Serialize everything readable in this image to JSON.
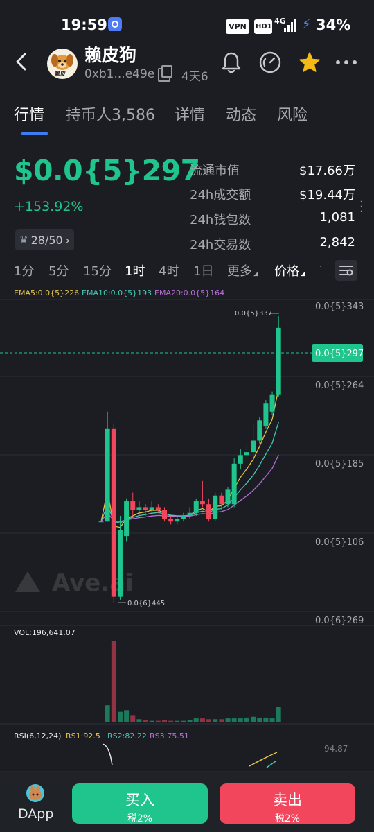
{
  "status_bar": {
    "time": "19:59",
    "vpn": "VPN",
    "hd": "HD1",
    "network": "4G",
    "battery": "34%"
  },
  "header": {
    "token_name": "赖皮狗",
    "address": "0xb1...e49e",
    "age": "4天6",
    "logo_text": "赖皮"
  },
  "tabs": [
    "行情",
    "持币人3,586",
    "详情",
    "动态",
    "风险"
  ],
  "price": {
    "value": "$0.0{5}297",
    "change": "+153.92%",
    "rank": "28/50"
  },
  "stats": [
    {
      "label": "流通市值",
      "value": "$17.66万"
    },
    {
      "label": "24h成交额",
      "value": "$19.44万"
    },
    {
      "label": "24h钱包数",
      "value": "1,081"
    },
    {
      "label": "24h交易数",
      "value": "2,842"
    }
  ],
  "timeframes": [
    "1分",
    "5分",
    "15分",
    "1时",
    "4时",
    "1日",
    "更多",
    "价格"
  ],
  "active_timeframe": "1时",
  "ema": {
    "ema5": "EMA5:0.0{5}226",
    "ema10": "EMA10:0.0{5}193",
    "ema20": "EMA20:0.0{5}164"
  },
  "chart": {
    "price_axis": [
      "0.0{5}343",
      "0.0{5}264",
      "0.0{5}185",
      "0.0{5}106",
      "0.0{6}269"
    ],
    "current_price_tag": "0.0{5}297",
    "high_label": "0.0{5}337",
    "low_label": "0.0{6}445",
    "watermark": "Ave.ai",
    "volume_label": "VOL:196,641.07",
    "rsi_label": "RSI(6,12,24)",
    "rsi1": "RS1:92.5",
    "rsi2": "RS2:82.22",
    "rsi3": "RS3:75.51",
    "rsi_axis": "94.87"
  },
  "colors": {
    "up": "#1fc58c",
    "down": "#f2465d",
    "ema5": "#e8c547",
    "ema10": "#46c7b4",
    "ema20": "#b76fd8",
    "accent": "#3d7cf2",
    "star": "#f5b915"
  },
  "chart_data": {
    "type": "candlestick",
    "interval": "1时",
    "candles_relative": [
      {
        "o": 0.28,
        "c": 0.28,
        "h": 0.28,
        "l": 0.28
      },
      {
        "o": 0.28,
        "c": 0.6,
        "h": 0.66,
        "l": 0.28
      },
      {
        "o": 0.6,
        "c": 0.02,
        "h": 0.62,
        "l": 0.0
      },
      {
        "o": 0.02,
        "c": 0.25,
        "h": 0.3,
        "l": 0.01
      },
      {
        "o": 0.23,
        "c": 0.35,
        "h": 0.36,
        "l": 0.21
      },
      {
        "o": 0.35,
        "c": 0.32,
        "h": 0.38,
        "l": 0.3
      },
      {
        "o": 0.32,
        "c": 0.33,
        "h": 0.35,
        "l": 0.3
      },
      {
        "o": 0.33,
        "c": 0.32,
        "h": 0.34,
        "l": 0.3
      },
      {
        "o": 0.32,
        "c": 0.33,
        "h": 0.35,
        "l": 0.31
      },
      {
        "o": 0.33,
        "c": 0.32,
        "h": 0.34,
        "l": 0.31
      },
      {
        "o": 0.32,
        "c": 0.29,
        "h": 0.33,
        "l": 0.28
      },
      {
        "o": 0.29,
        "c": 0.28,
        "h": 0.3,
        "l": 0.27
      },
      {
        "o": 0.28,
        "c": 0.29,
        "h": 0.3,
        "l": 0.27
      },
      {
        "o": 0.29,
        "c": 0.3,
        "h": 0.31,
        "l": 0.28
      },
      {
        "o": 0.3,
        "c": 0.31,
        "h": 0.33,
        "l": 0.29
      },
      {
        "o": 0.31,
        "c": 0.35,
        "h": 0.36,
        "l": 0.3
      },
      {
        "o": 0.35,
        "c": 0.34,
        "h": 0.42,
        "l": 0.33
      },
      {
        "o": 0.34,
        "c": 0.29,
        "h": 0.36,
        "l": 0.28
      },
      {
        "o": 0.29,
        "c": 0.37,
        "h": 0.38,
        "l": 0.28
      },
      {
        "o": 0.37,
        "c": 0.34,
        "h": 0.38,
        "l": 0.32
      },
      {
        "o": 0.34,
        "c": 0.39,
        "h": 0.4,
        "l": 0.33
      },
      {
        "o": 0.34,
        "c": 0.48,
        "h": 0.5,
        "l": 0.33
      },
      {
        "o": 0.48,
        "c": 0.51,
        "h": 0.53,
        "l": 0.46
      },
      {
        "o": 0.51,
        "c": 0.52,
        "h": 0.55,
        "l": 0.49
      },
      {
        "o": 0.52,
        "c": 0.56,
        "h": 0.62,
        "l": 0.5
      },
      {
        "o": 0.56,
        "c": 0.63,
        "h": 0.64,
        "l": 0.55
      },
      {
        "o": 0.61,
        "c": 0.69,
        "h": 0.7,
        "l": 0.6
      },
      {
        "o": 0.66,
        "c": 0.72,
        "h": 0.73,
        "l": 0.65
      },
      {
        "o": 0.72,
        "c": 0.95,
        "h": 0.99,
        "l": 0.71
      }
    ],
    "volumes_relative": [
      0.0,
      0.21,
      1.0,
      0.13,
      0.15,
      0.09,
      0.04,
      0.03,
      0.02,
      0.02,
      0.03,
      0.02,
      0.02,
      0.02,
      0.03,
      0.05,
      0.05,
      0.04,
      0.04,
      0.04,
      0.05,
      0.05,
      0.05,
      0.06,
      0.07,
      0.06,
      0.06,
      0.05,
      0.19
    ],
    "ema5_values": "EMA5:0.0{5}226",
    "ema10_values": "EMA10:0.0{5}193",
    "ema20_values": "EMA20:0.0{5}164"
  },
  "bottom": {
    "dapp": "DApp",
    "buy": "买入",
    "buy_tax": "税2%",
    "sell": "卖出",
    "sell_tax": "税2%"
  }
}
